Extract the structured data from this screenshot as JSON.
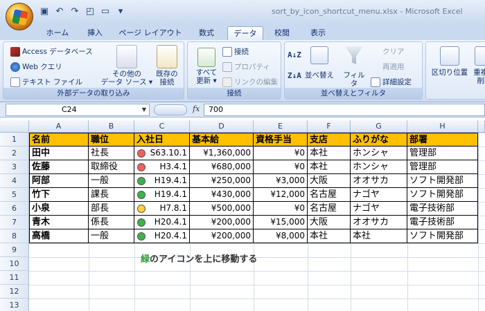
{
  "window": {
    "title": "sort_by_icon_shortcut_menu.xlsx - Microsoft Excel"
  },
  "tabs": [
    {
      "label": "ホーム",
      "active": false
    },
    {
      "label": "挿入",
      "active": false
    },
    {
      "label": "ページ レイアウト",
      "active": false
    },
    {
      "label": "数式",
      "active": false
    },
    {
      "label": "データ",
      "active": true
    },
    {
      "label": "校閲",
      "active": false
    },
    {
      "label": "表示",
      "active": false
    }
  ],
  "ribbon": {
    "external": {
      "access": "Access データベース",
      "web": "Web クエリ",
      "text": "テキスト ファイル",
      "other_1": "その他の",
      "other_2": "データ ソース ▾",
      "existing_1": "既存の",
      "existing_2": "接続",
      "label": "外部データの取り込み"
    },
    "connections": {
      "refresh_1": "すべて",
      "refresh_2": "更新 ▾",
      "connect": "接続",
      "properties": "プロパティ",
      "edit_links": "リンクの編集",
      "label": "接続"
    },
    "sort": {
      "az": "A↓Z",
      "za": "Z↓A",
      "sort": "並べ替え",
      "filter": "フィルタ",
      "clear": "クリア",
      "reapply": "再適用",
      "advanced": "詳細設定",
      "label": "並べ替えとフィルタ"
    },
    "tools": {
      "text_to_columns": "区切り位置",
      "remove_dup": "重複の削除"
    }
  },
  "formula_bar": {
    "name_box": "C24",
    "fx": "fx",
    "value": "700"
  },
  "columns": [
    "A",
    "B",
    "C",
    "D",
    "E",
    "F",
    "G",
    "H"
  ],
  "rows": [
    "1",
    "2",
    "3",
    "4",
    "5",
    "6",
    "7",
    "8",
    "9",
    "10",
    "11",
    "12",
    "13"
  ],
  "table": {
    "headers": [
      "名前",
      "職位",
      "入社日",
      "基本給",
      "資格手当",
      "支店",
      "ふりがな",
      "部署"
    ],
    "rows": [
      {
        "name": "田中",
        "title": "社長",
        "icon": "red",
        "date": "S63.10.1",
        "salary": "¥1,360,000",
        "allowance": "¥0",
        "branch": "本社",
        "kana": "ホンシャ",
        "dept": "管理部"
      },
      {
        "name": "佐藤",
        "title": "取締役",
        "icon": "red",
        "date": "H3.4.1",
        "salary": "¥680,000",
        "allowance": "¥0",
        "branch": "本社",
        "kana": "ホンシャ",
        "dept": "管理部"
      },
      {
        "name": "阿部",
        "title": "一般",
        "icon": "green",
        "date": "H19.4.1",
        "salary": "¥250,000",
        "allowance": "¥3,000",
        "branch": "大阪",
        "kana": "オオサカ",
        "dept": "ソフト開発部"
      },
      {
        "name": "竹下",
        "title": "課長",
        "icon": "green",
        "date": "H19.4.1",
        "salary": "¥430,000",
        "allowance": "¥12,000",
        "branch": "名古屋",
        "kana": "ナゴヤ",
        "dept": "ソフト開発部"
      },
      {
        "name": "小泉",
        "title": "部長",
        "icon": "yellow",
        "date": "H7.8.1",
        "salary": "¥500,000",
        "allowance": "¥0",
        "branch": "名古屋",
        "kana": "ナゴヤ",
        "dept": "電子技術部"
      },
      {
        "name": "青木",
        "title": "係長",
        "icon": "green",
        "date": "H20.4.1",
        "salary": "¥200,000",
        "allowance": "¥15,000",
        "branch": "大阪",
        "kana": "オオサカ",
        "dept": "電子技術部"
      },
      {
        "name": "高橋",
        "title": "一般",
        "icon": "green",
        "date": "H20.4.1",
        "salary": "¥200,000",
        "allowance": "¥8,000",
        "branch": "本社",
        "kana": "本社",
        "dept": "ソフト開発部"
      }
    ]
  },
  "note": {
    "green": "緑",
    "rest": "のアイコンを上に移動する"
  },
  "colors": {
    "header_fill": "#ffc000",
    "icon_red": "#f06060",
    "icon_yellow": "#ffd23a",
    "icon_green": "#3fb24a",
    "note_green": "#2e9a3c"
  }
}
